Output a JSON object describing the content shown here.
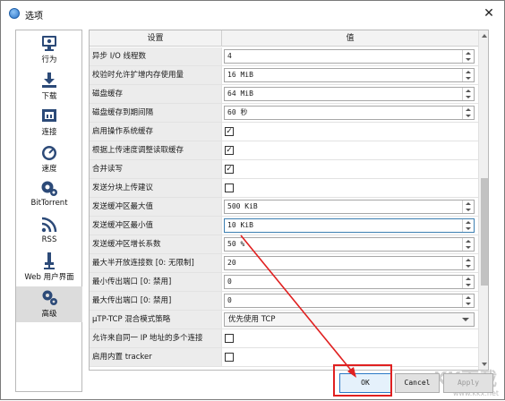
{
  "window": {
    "title": "选项",
    "close_glyph": "✕"
  },
  "sidebar": {
    "items": [
      {
        "label": "行为",
        "icon": "monitor-icon"
      },
      {
        "label": "下载",
        "icon": "download-icon"
      },
      {
        "label": "连接",
        "icon": "network-icon"
      },
      {
        "label": "速度",
        "icon": "speedometer-icon"
      },
      {
        "label": "BitTorrent",
        "icon": "bittorrent-icon"
      },
      {
        "label": "RSS",
        "icon": "rss-icon"
      },
      {
        "label": "Web 用户界面",
        "icon": "web-ui-icon"
      },
      {
        "label": "高级",
        "icon": "gears-icon",
        "active": true
      }
    ]
  },
  "table": {
    "headers": {
      "setting": "设置",
      "value": "值"
    },
    "rows": [
      {
        "key": "异步 I/O 线程数",
        "type": "spin",
        "value": "4"
      },
      {
        "key": "校验时允许扩增内存使用量",
        "type": "spin",
        "value": "16 MiB"
      },
      {
        "key": "磁盘缓存",
        "type": "spin",
        "value": "64 MiB"
      },
      {
        "key": "磁盘缓存到期间隔",
        "type": "spin",
        "value": "60 秒"
      },
      {
        "key": "启用操作系统缓存",
        "type": "check",
        "checked": true
      },
      {
        "key": "根据上传速度调整读取缓存",
        "type": "check",
        "checked": true
      },
      {
        "key": "合并读写",
        "type": "check",
        "checked": true
      },
      {
        "key": "发送分块上传建议",
        "type": "check",
        "checked": false
      },
      {
        "key": "发送缓冲区最大值",
        "type": "spin",
        "value": "500 KiB"
      },
      {
        "key": "发送缓冲区最小值",
        "type": "spin",
        "value": "10 KiB",
        "focused": true
      },
      {
        "key": "发送缓冲区增长系数",
        "type": "spin",
        "value": "50 %"
      },
      {
        "key": "最大半开放连接数 [0: 无限制]",
        "type": "spin",
        "value": "20"
      },
      {
        "key": "最小传出端口 [0: 禁用]",
        "type": "spin",
        "value": "0"
      },
      {
        "key": "最大传出端口 [0: 禁用]",
        "type": "spin",
        "value": "0"
      },
      {
        "key": "μTP-TCP 混合模式策略",
        "type": "combo",
        "value": "优先使用 TCP"
      },
      {
        "key": "允许来自同一 IP 地址的多个连接",
        "type": "check",
        "checked": false
      },
      {
        "key": "启用内置 tracker",
        "type": "check",
        "checked": false
      }
    ]
  },
  "buttons": {
    "ok": "OK",
    "cancel": "Cancel",
    "apply": "Apply"
  },
  "watermark": {
    "logo": "KK下载",
    "url": "www.kkx.net"
  },
  "colors": {
    "highlight": "#e02020",
    "ok_border": "#2b79c5",
    "sidebar_active": "#dcdcdc"
  }
}
